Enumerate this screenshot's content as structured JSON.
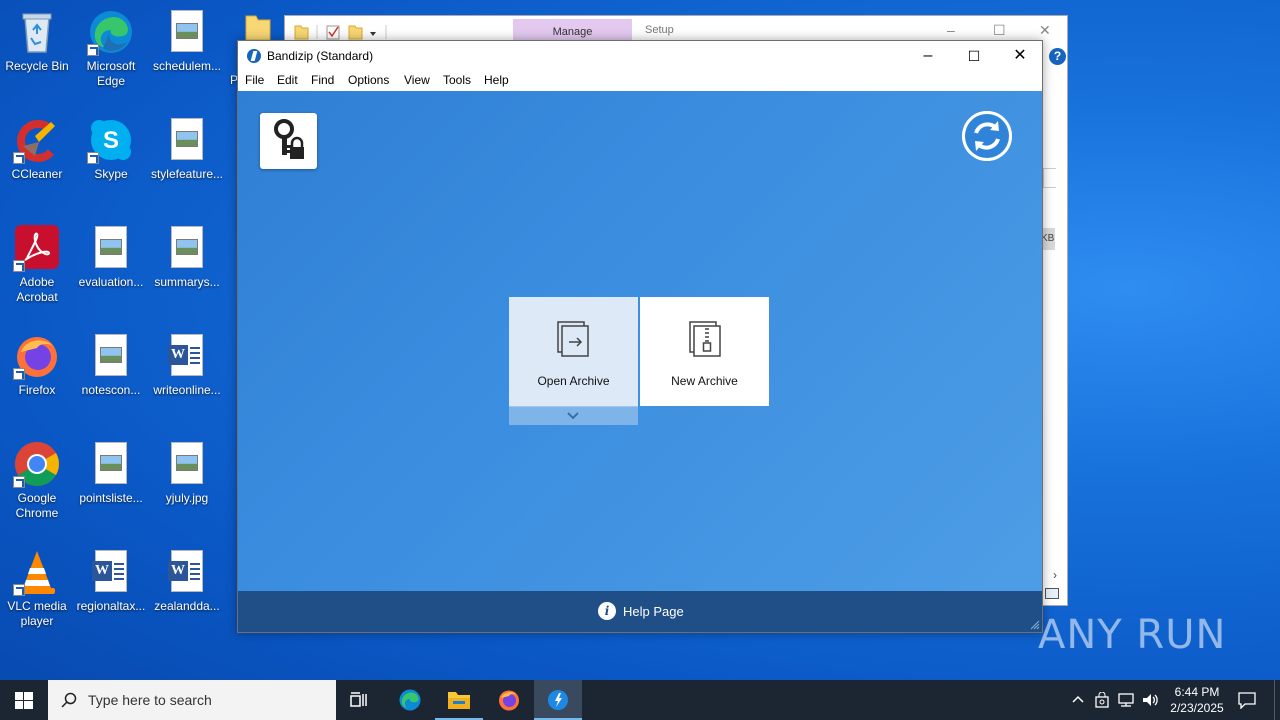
{
  "desktop": {
    "icons": [
      {
        "label": "Recycle Bin"
      },
      {
        "label": "Microsoft Edge"
      },
      {
        "label": "schedulem..."
      },
      {
        "label": "CCleaner"
      },
      {
        "label": "Skype"
      },
      {
        "label": "stylefeature..."
      },
      {
        "label": "Adobe Acrobat"
      },
      {
        "label": "evaluation..."
      },
      {
        "label": "summarys..."
      },
      {
        "label": "Firefox"
      },
      {
        "label": "notescon..."
      },
      {
        "label": "writeonline..."
      },
      {
        "label": "Google Chrome"
      },
      {
        "label": "pointsliste..."
      },
      {
        "label": "yjuly.jpg"
      },
      {
        "label": "VLC media player"
      },
      {
        "label": "regionaltax..."
      },
      {
        "label": "zealandda..."
      }
    ]
  },
  "bg_window": {
    "manage_tab": "Manage",
    "setup_tab": "Setup",
    "partial_left_char": "P",
    "size_fragment": "KB"
  },
  "bandizip": {
    "title": "Bandizip (Standard)",
    "menu": [
      "File",
      "Edit",
      "Find",
      "Options",
      "View",
      "Tools",
      "Help"
    ],
    "tiles": {
      "open_label": "Open Archive",
      "new_label": "New Archive"
    },
    "footer": {
      "help_label": "Help Page"
    },
    "icons": {
      "key": "key-lock-icon",
      "refresh": "refresh-icon",
      "dropdown": "chevron-down-icon"
    },
    "colors": {
      "body_blue": "#3a8ddf",
      "footer_blue": "#1f4f86"
    }
  },
  "watermark": {
    "text": "ANY RUN"
  },
  "taskbar": {
    "search_placeholder": "Type here to search",
    "time": "6:44 PM",
    "date": "2/23/2025"
  }
}
